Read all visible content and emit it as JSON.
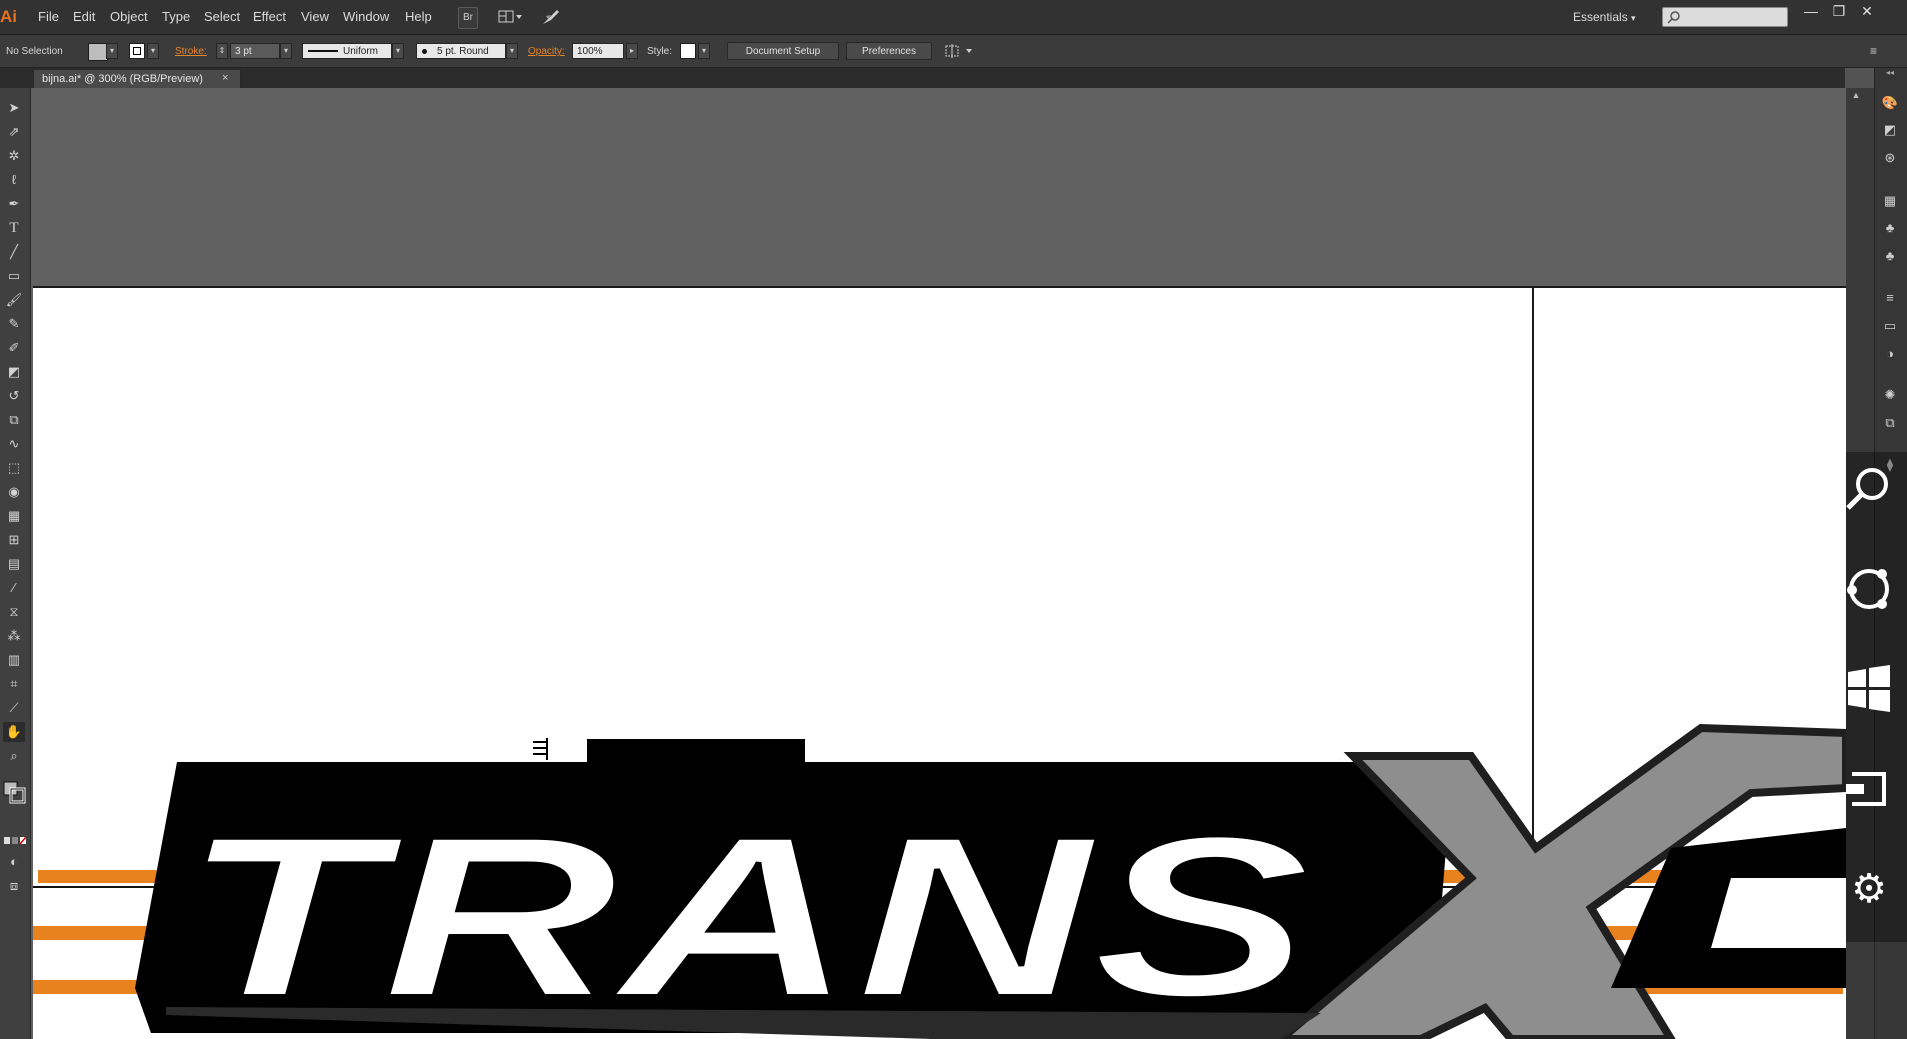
{
  "app": {
    "logo": "Ai"
  },
  "menu": [
    "File",
    "Edit",
    "Object",
    "Type",
    "Select",
    "Effect",
    "View",
    "Window",
    "Help"
  ],
  "menubar_buttons": {
    "bridge": "Br"
  },
  "workspace": {
    "label": "Essentials",
    "arrow": "▾"
  },
  "window_controls": {
    "minimize": "—",
    "restore": "❐",
    "close": "✕"
  },
  "control": {
    "selection_status": "No Selection",
    "stroke_label": "Stroke:",
    "stroke_weight": "3 pt",
    "stroke_profile": "Uniform",
    "brush": "5 pt. Round",
    "opacity_label": "Opacity:",
    "opacity_value": "100%",
    "style_label": "Style:",
    "document_setup": "Document Setup",
    "preferences": "Preferences"
  },
  "document_tab": {
    "title": "bijna.ai* @ 300% (RGB/Preview)",
    "close": "×"
  },
  "artwork": {
    "text": "TRANS",
    "x_letter": "X",
    "accent_color": "#e8821e",
    "gray_color": "#8e8e8e"
  },
  "icons": {
    "tools": [
      "selection-tool-icon",
      "direct-selection-tool-icon",
      "magic-wand-tool-icon",
      "lasso-tool-icon",
      "pen-tool-icon",
      "type-tool-icon",
      "line-segment-tool-icon",
      "rectangle-tool-icon",
      "paintbrush-tool-icon",
      "pencil-tool-icon",
      "blob-brush-tool-icon",
      "eraser-tool-icon",
      "rotate-tool-icon",
      "scale-tool-icon",
      "warp-tool-icon",
      "free-transform-tool-icon",
      "shape-builder-tool-icon",
      "perspective-grid-tool-icon",
      "mesh-tool-icon",
      "gradient-tool-icon",
      "eyedropper-tool-icon",
      "blend-tool-icon",
      "symbol-sprayer-tool-icon",
      "column-graph-tool-icon",
      "artboard-tool-icon",
      "slice-tool-icon",
      "hand-tool-icon",
      "zoom-tool-icon"
    ],
    "dock": [
      "color-panel-icon",
      "color-guide-icon",
      "kuler-icon",
      "swatches-icon",
      "brushes-icon",
      "symbols-icon",
      "stroke-panel-icon",
      "gradient-panel-icon",
      "transparency-panel-icon",
      "appearance-panel-icon",
      "graphic-styles-icon",
      "layers-panel-icon"
    ],
    "charms": [
      "search-charm-icon",
      "share-charm-icon",
      "start-charm-icon",
      "devices-charm-icon",
      "settings-charm-icon"
    ]
  }
}
